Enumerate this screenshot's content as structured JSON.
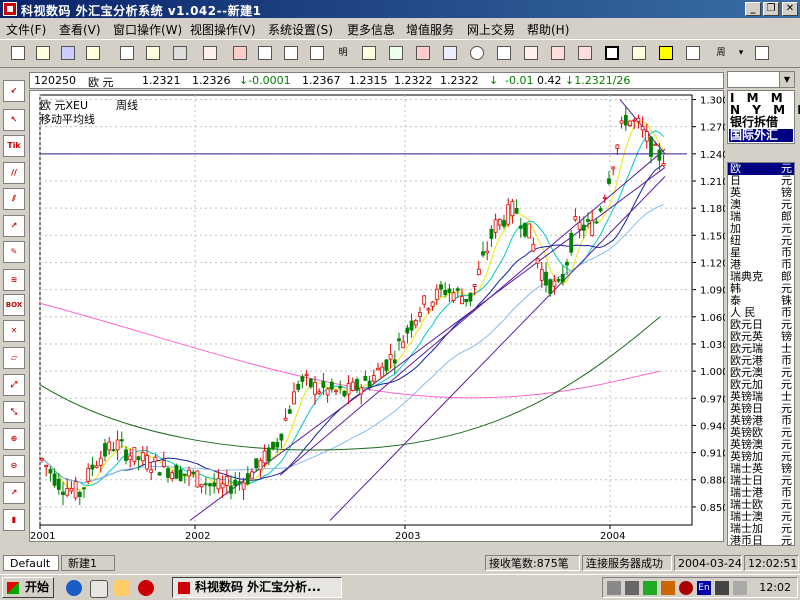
{
  "window": {
    "title": "科视数码 外汇宝分析系统 v1.042--新建1",
    "min": "_",
    "restore": "❐",
    "close": "✕"
  },
  "menu": [
    "文件(F)",
    "查看(V)",
    "窗口操作(W)",
    "视图操作(V)",
    "系统设置(S)",
    "更多信息",
    "增值服务",
    "网上交易",
    "帮助(H)"
  ],
  "toolbar": {
    "icons": [
      "new-doc-icon",
      "open-icon",
      "save-icon",
      "copy-icon",
      "paste-icon",
      "print-icon",
      "line-tool-icon",
      "delete-icon",
      "window-icon",
      "window2-icon",
      "list-icon",
      "明",
      "stock-icon",
      "up-arrow-icon",
      "grid-icon",
      "clock-icon",
      "data-icon",
      "report-icon",
      "buy-sell-icon",
      "refresh-icon",
      "panel-icon",
      "help-icon",
      "warning-icon",
      "calc-icon"
    ],
    "period_label": "周",
    "ming_label": "明"
  },
  "quote": {
    "code": "120250",
    "name": "欧  元",
    "v1": "1.2321",
    "v2": "1.2326",
    "change": "↓-0.0001",
    "v3": "1.2367",
    "v4": "1.2315",
    "v5": "1.2322",
    "v6": "1.2322",
    "arrow": "↓",
    "pct": "-0.01",
    "ratio": "0.42",
    "last": "↓1.2321/26"
  },
  "chart_header": {
    "line1a": "欧  元XEU",
    "line1b": "周线",
    "line2": "移动平均线"
  },
  "chart_data": {
    "type": "candlestick",
    "y_ticks": [
      "1.3000",
      "1.2700",
      "1.2400",
      "1.2100",
      "1.1800",
      "1.1500",
      "1.1200",
      "1.0900",
      "1.0600",
      "1.0300",
      "1.0000",
      "0.9700",
      "0.9400",
      "0.9100",
      "0.8800",
      "0.8500"
    ],
    "x_ticks": [
      "2001",
      "2002",
      "2003",
      "2004"
    ],
    "ylim": [
      0.83,
      1.305
    ],
    "horizontal_line": 1.24
  },
  "right_panel": {
    "select_value": "",
    "top_rows": [
      "I M M",
      "N Y M E",
      "银行拆借",
      "国际外汇"
    ],
    "list_heading": "欧  元",
    "list": [
      [
        "欧",
        "元"
      ],
      [
        "日",
        "元"
      ],
      [
        "英",
        "镑"
      ],
      [
        "澳",
        "元"
      ],
      [
        "瑞",
        "郎"
      ],
      [
        "加",
        "元"
      ],
      [
        "纽",
        "元"
      ],
      [
        "星",
        "币"
      ],
      [
        "港",
        "币"
      ],
      [
        "瑞典克",
        "郎"
      ],
      [
        "韩",
        "元"
      ],
      [
        "泰",
        "铢"
      ],
      [
        "人  民",
        "币"
      ],
      [
        "欧元日",
        "元"
      ],
      [
        "欧元英",
        "镑"
      ],
      [
        "欧元瑞",
        "士"
      ],
      [
        "欧元港",
        "币"
      ],
      [
        "欧元澳",
        "元"
      ],
      [
        "欧元加",
        "元"
      ],
      [
        "英镑瑞",
        "士"
      ],
      [
        "英镑日",
        "元"
      ],
      [
        "英镑港",
        "币"
      ],
      [
        "英镑欧",
        "元"
      ],
      [
        "英镑澳",
        "元"
      ],
      [
        "英镑加",
        "元"
      ],
      [
        "瑞士英",
        "镑"
      ],
      [
        "瑞士日",
        "元"
      ],
      [
        "瑞士港",
        "币"
      ],
      [
        "瑞士欧",
        "元"
      ],
      [
        "瑞士澳",
        "元"
      ],
      [
        "瑞士加",
        "元"
      ],
      [
        "港币日",
        "元"
      ]
    ]
  },
  "tabs": [
    "Default",
    "新建1"
  ],
  "status": {
    "received": "接收笔数:875笔",
    "server": "连接服务器成功",
    "date": "2004-03-24",
    "time": "12:02:51"
  },
  "taskbar": {
    "start": "开始",
    "task": "科视数码 外汇宝分析...",
    "clock": "12:02",
    "ime": "En"
  }
}
